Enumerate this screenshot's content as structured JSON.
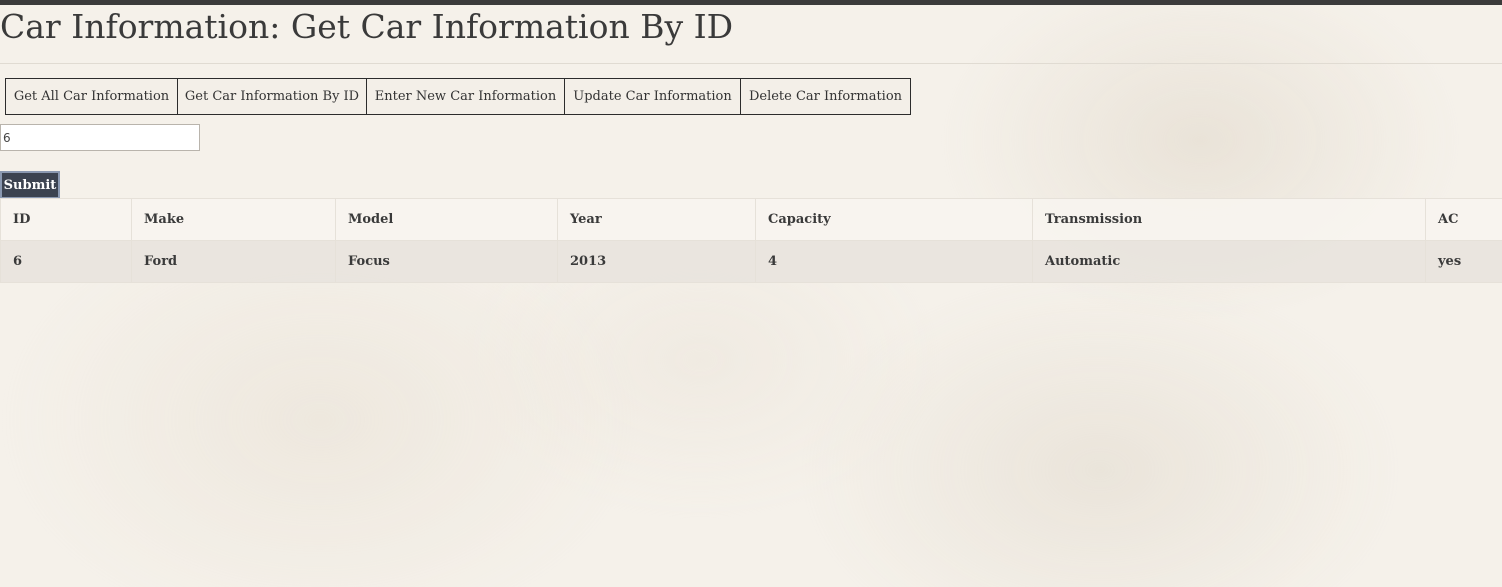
{
  "page": {
    "title": "Car Information: Get Car Information By ID"
  },
  "nav": {
    "items": [
      {
        "label": "Get All Car Information"
      },
      {
        "label": "Get Car Information By ID"
      },
      {
        "label": "Enter New Car Information"
      },
      {
        "label": "Update Car Information"
      },
      {
        "label": "Delete Car Information"
      }
    ]
  },
  "form": {
    "id_value": "6",
    "submit_label": "Submit"
  },
  "table": {
    "columns": [
      "ID",
      "Make",
      "Model",
      "Year",
      "Capacity",
      "Transmission",
      "AC"
    ],
    "rows": [
      [
        "6",
        "Ford",
        "Focus",
        "2013",
        "4",
        "Automatic",
        "yes"
      ]
    ]
  },
  "colors": {
    "background": "#f5f1ea",
    "topbar": "#3b3b3b",
    "submit_bg": "#3c4350",
    "submit_border": "#8a98b0"
  }
}
